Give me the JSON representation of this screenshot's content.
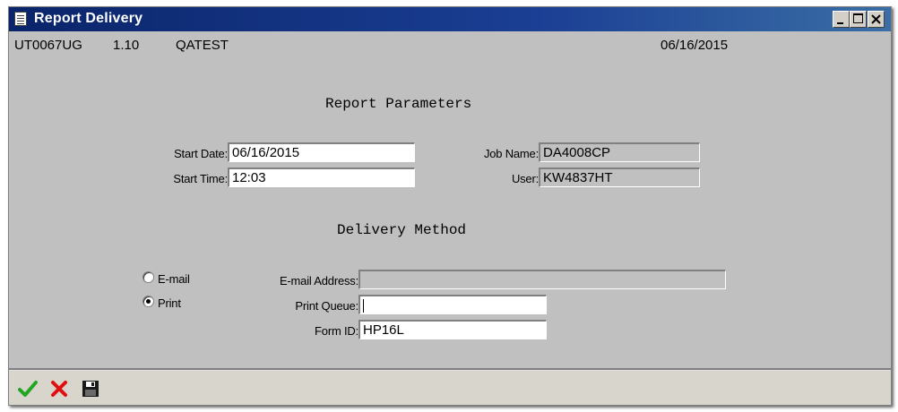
{
  "window": {
    "title": "Report Delivery"
  },
  "info": {
    "program": "UT0067UG",
    "version": "1.10",
    "environment": "QATEST",
    "date": "06/16/2015"
  },
  "parameters": {
    "heading": "Report Parameters",
    "start_date_label": "Start Date:",
    "start_date_value": "06/16/2015",
    "start_time_label": "Start Time:",
    "start_time_value": "12:03",
    "job_name_label": "Job Name:",
    "job_name_value": "DA4008CP",
    "user_label": "User:",
    "user_value": "KW4837HT"
  },
  "delivery": {
    "heading": "Delivery Method",
    "email_option_label": "E-mail",
    "print_option_label": "Print",
    "selected": "Print",
    "email_address_label": "E-mail Address:",
    "email_address_value": "",
    "print_queue_label": "Print Queue:",
    "print_queue_value": "",
    "form_id_label": "Form ID:",
    "form_id_value": "HP16L"
  },
  "toolbar": {
    "accept_icon": "checkmark-icon",
    "cancel_icon": "x-icon",
    "save_icon": "floppy-disk-icon",
    "accept_color": "#22a622",
    "cancel_color": "#e01010"
  }
}
